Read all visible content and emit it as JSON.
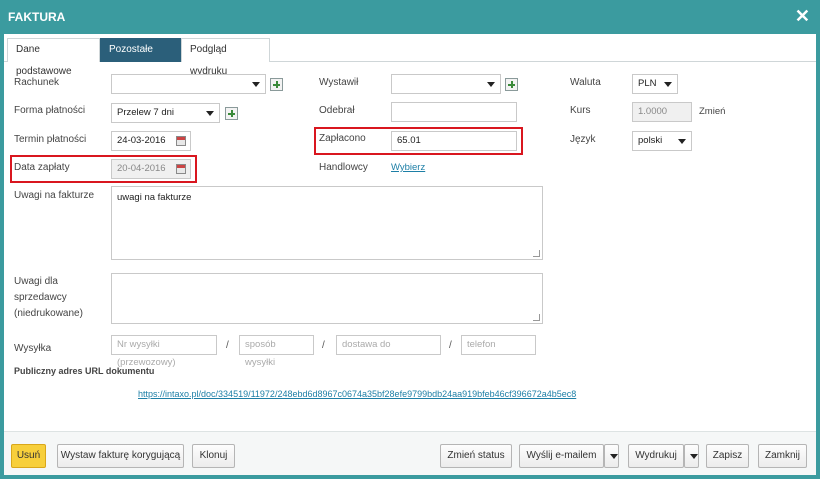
{
  "window": {
    "title": "FAKTURA",
    "close_icon": "close-icon"
  },
  "tabs": [
    {
      "label": "Dane podstawowe"
    },
    {
      "label": "Pozostałe dane"
    },
    {
      "label": "Podgląd wydruku"
    }
  ],
  "form": {
    "rachunek": {
      "label": "Rachunek",
      "value": ""
    },
    "forma_platnosci": {
      "label": "Forma płatności",
      "value": "Przelew 7 dni"
    },
    "termin_platnosci": {
      "label": "Termin płatności",
      "value": "24-03-2016"
    },
    "data_zaplaty": {
      "label": "Data zapłaty",
      "value": "20-04-2016"
    },
    "wystawil": {
      "label": "Wystawił",
      "value": ""
    },
    "odebral": {
      "label": "Odebrał",
      "value": ""
    },
    "zaplacono": {
      "label": "Zapłacono",
      "value": "65.01"
    },
    "handlowcy": {
      "label": "Handlowcy",
      "link": "Wybierz"
    },
    "waluta": {
      "label": "Waluta",
      "value": "PLN"
    },
    "kurs": {
      "label": "Kurs",
      "value": "1.0000",
      "action": "Zmień"
    },
    "jezyk": {
      "label": "Język",
      "value": "polski"
    },
    "uwagi_na_fakturze": {
      "label": "Uwagi na fakturze",
      "value": "uwagi na fakturze"
    },
    "uwagi_dla_sprzedawcy": {
      "label_1": "Uwagi dla",
      "label_2": "sprzedawcy",
      "label_3": "(niedrukowane)",
      "value": ""
    },
    "wysylka": {
      "label": "Wysyłka",
      "sep": "/",
      "placeholders": [
        "Nr wysyłki (przewozowy)",
        "sposób wysyłki",
        "dostawa do",
        "telefon"
      ]
    },
    "public_url": {
      "label": "Publiczny adres URL dokumentu",
      "url": "https://intaxo.pl/doc/334519/11972/248ebd6d8967c0674a35bf28efe9799bdb24aa919bfeb46cf396672a4b5ec8"
    }
  },
  "footer": {
    "usun": "Usuń",
    "korygujaca": "Wystaw fakturę korygującą",
    "klonuj": "Klonuj",
    "zmien_status": "Zmień status",
    "wyslij": "Wyślij e-mailem",
    "wydrukuj": "Wydrukuj",
    "zapisz": "Zapisz",
    "zamknij": "Zamknij"
  },
  "colors": {
    "header": "#3b9b9f",
    "active_tab": "#2b5f7a",
    "highlight": "#d9161f",
    "delete_button": "#f7cf3b",
    "link": "#1d7fa6"
  }
}
